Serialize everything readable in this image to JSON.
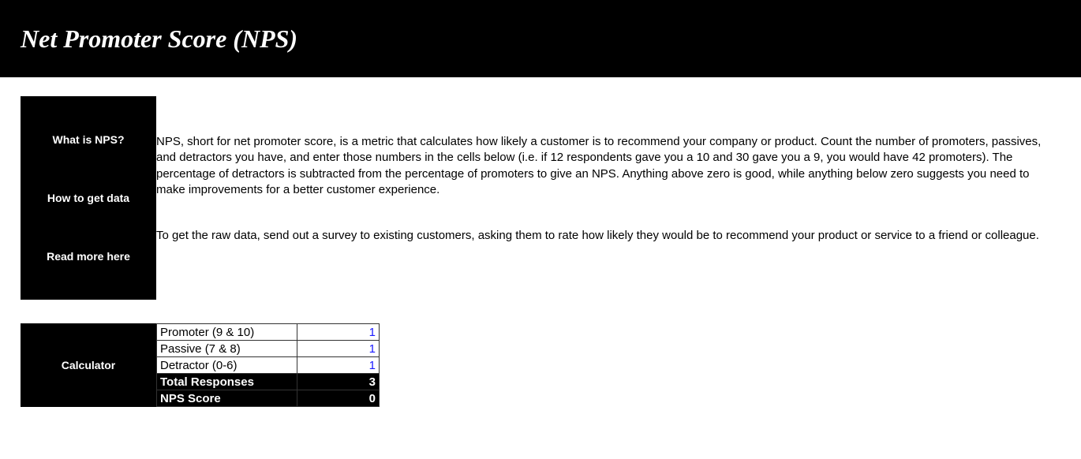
{
  "header": {
    "title": "Net Promoter Score (NPS)"
  },
  "sidebar1": {
    "what": "What is NPS?",
    "how": "How to get data",
    "read": "Read more here"
  },
  "text": {
    "what": "NPS, short for net promoter score, is a metric that calculates how likely a customer is to recommend your company or product. Count the number of promoters, passives, and detractors you have, and enter those numbers in the cells below (i.e. if 12 respondents gave you a 10 and 30 gave you a 9, you would have 42 promoters). The percentage of detractors is subtracted from the percentage of promoters to give an NPS. Anything above zero is good, while anything below zero suggests you need to make improvements for a better customer experience.",
    "how": "To get the raw data, send out a survey to existing customers, asking them to rate how likely they would be to recommend your product or service to a friend or colleague."
  },
  "calculator": {
    "title": "Calculator",
    "rows": {
      "promoter": {
        "label": "Promoter (9 & 10)",
        "value": "1"
      },
      "passive": {
        "label": "Passive (7 & 8)",
        "value": "1"
      },
      "detractor": {
        "label": "Detractor (0-6)",
        "value": "1"
      },
      "total": {
        "label": "Total Responses",
        "value": "3"
      },
      "score": {
        "label": "NPS Score",
        "value": "0"
      }
    }
  }
}
